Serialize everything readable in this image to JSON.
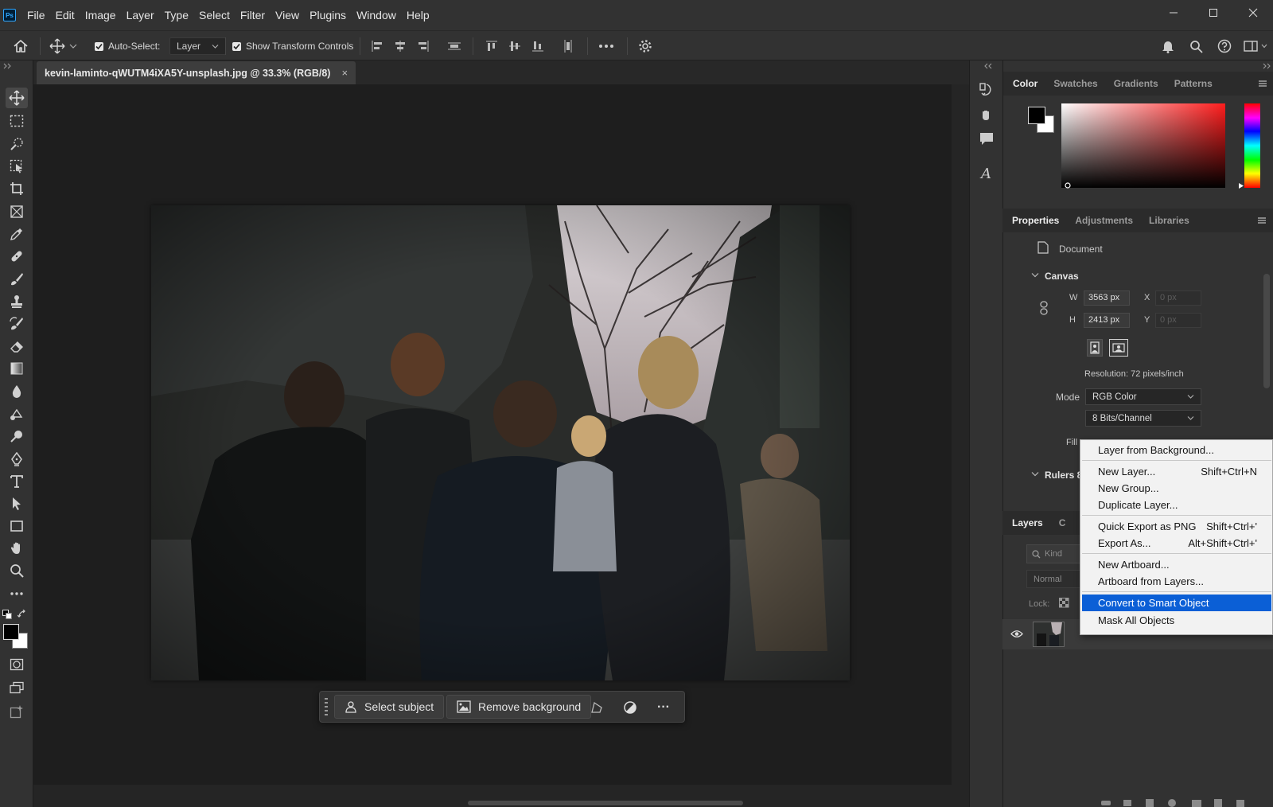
{
  "app": {
    "logo": "Ps"
  },
  "menubar": {
    "items": [
      "File",
      "Edit",
      "Image",
      "Layer",
      "Type",
      "Select",
      "Filter",
      "View",
      "Plugins",
      "Window",
      "Help"
    ]
  },
  "options": {
    "auto_select_label": "Auto-Select:",
    "auto_select_value": "Layer",
    "show_transform_label": "Show Transform Controls"
  },
  "document": {
    "tab_title": "kevin-laminto-qWUTM4iXA5Y-unsplash.jpg @ 33.3% (RGB/8)",
    "tab_close": "×"
  },
  "taskbar": {
    "select_subject": "Select subject",
    "remove_background": "Remove background",
    "more": "···"
  },
  "color_panel": {
    "tabs": [
      "Color",
      "Swatches",
      "Gradients",
      "Patterns"
    ],
    "foreground": "#000000",
    "background": "#ffffff"
  },
  "properties_panel": {
    "tabs": [
      "Properties",
      "Adjustments",
      "Libraries"
    ],
    "document_label": "Document",
    "canvas_heading": "Canvas",
    "w_label": "W",
    "w_value": "3563 px",
    "h_label": "H",
    "h_value": "2413 px",
    "x_label": "X",
    "x_value": "0 px",
    "y_label": "Y",
    "y_value": "0 px",
    "resolution": "Resolution: 72 pixels/inch",
    "mode_label": "Mode",
    "mode_value": "RGB Color",
    "bits_value": "8 Bits/Channel",
    "fill_label": "Fill",
    "rulers_heading": "Rulers 8"
  },
  "layers_panel": {
    "tab": "Layers",
    "tab2": "C",
    "kind_placeholder": "Kind",
    "blend_mode": "Normal",
    "lock_label": "Lock:"
  },
  "context_menu": {
    "items": [
      {
        "label": "Layer from Background...",
        "shortcut": ""
      },
      {
        "label": "New Layer...",
        "shortcut": "Shift+Ctrl+N"
      },
      {
        "label": "New Group...",
        "shortcut": ""
      },
      {
        "label": "Duplicate Layer...",
        "shortcut": ""
      },
      {
        "label": "Quick Export as PNG",
        "shortcut": "Shift+Ctrl+'"
      },
      {
        "label": "Export As...",
        "shortcut": "Alt+Shift+Ctrl+'"
      },
      {
        "label": "New Artboard...",
        "shortcut": ""
      },
      {
        "label": "Artboard from Layers...",
        "shortcut": ""
      },
      {
        "label": "Convert to Smart Object",
        "shortcut": ""
      },
      {
        "label": "Mask All Objects",
        "shortcut": ""
      }
    ],
    "highlight_color": "#0b5fd6"
  }
}
